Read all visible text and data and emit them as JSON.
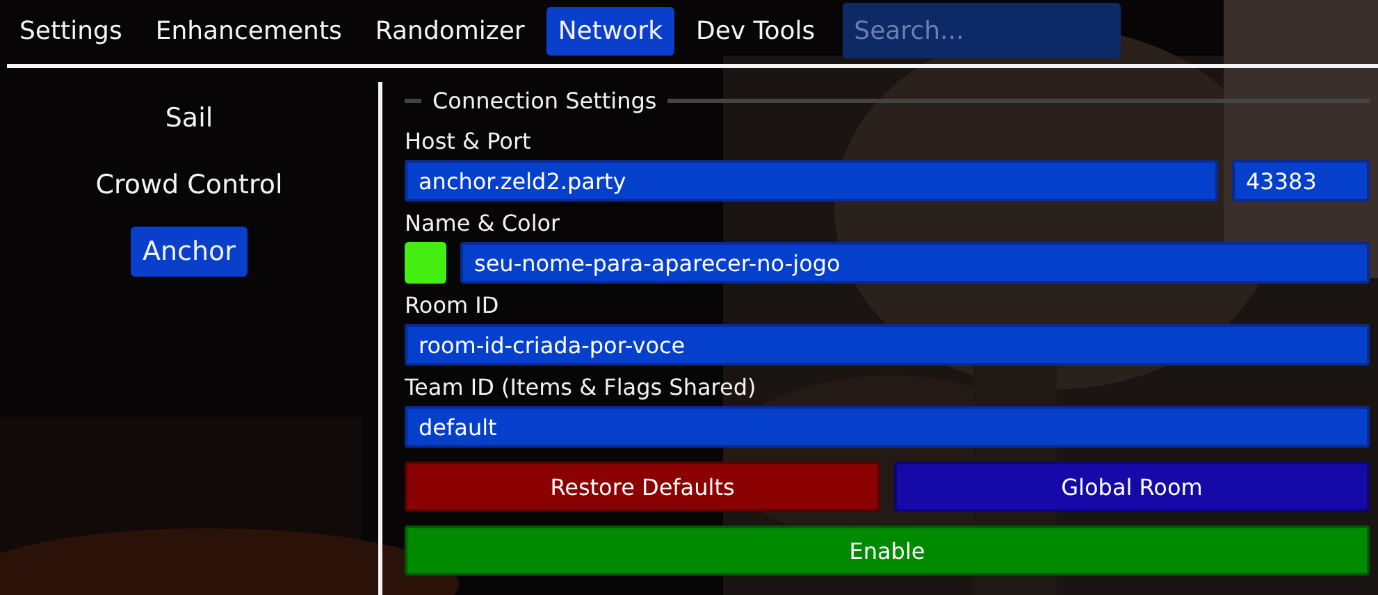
{
  "tabs": [
    {
      "label": "Settings",
      "selected": false
    },
    {
      "label": "Enhancements",
      "selected": false
    },
    {
      "label": "Randomizer",
      "selected": false
    },
    {
      "label": "Network",
      "selected": true
    },
    {
      "label": "Dev Tools",
      "selected": false
    }
  ],
  "search": {
    "placeholder": "Search..."
  },
  "sidebar": {
    "items": [
      {
        "label": "Sail",
        "selected": false
      },
      {
        "label": "Crowd Control",
        "selected": false
      },
      {
        "label": "Anchor",
        "selected": true
      }
    ]
  },
  "connection_settings": {
    "title": "Connection Settings",
    "host_port": {
      "label": "Host & Port",
      "host": "anchor.zeld2.party",
      "port": "43383"
    },
    "name_color": {
      "label": "Name & Color",
      "color": "#44ee11",
      "name": "seu-nome-para-aparecer-no-jogo"
    },
    "room_id": {
      "label": "Room ID",
      "value": "room-id-criada-por-voce"
    },
    "team_id": {
      "label": "Team ID (Items & Flags Shared)",
      "value": "default"
    },
    "button_rows": [
      [
        {
          "label": "Restore Defaults",
          "color": "#8b0000"
        },
        {
          "label": "Global Room",
          "color": "#150aa8"
        }
      ],
      [
        {
          "label": "Enable",
          "color": "#008a00"
        }
      ]
    ]
  }
}
